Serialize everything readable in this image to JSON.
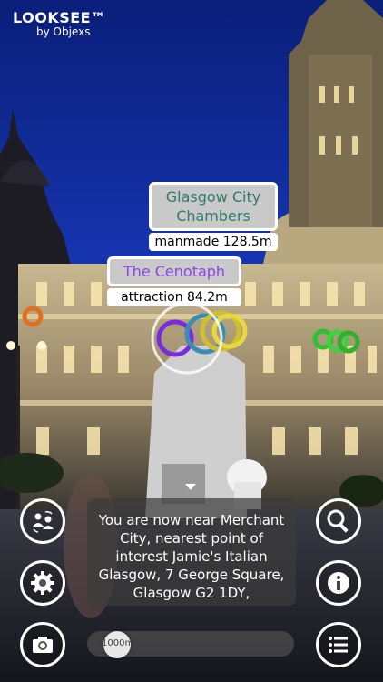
{
  "app": {
    "brand": "LOOKSEE™",
    "byline": "by Objexs"
  },
  "pois": [
    {
      "name": "Glasgow City Chambers",
      "category_distance": "manmade 128.5m"
    },
    {
      "name": "The Cenotaph",
      "category_distance": "attraction 84.2m"
    }
  ],
  "message": "You are now near Merchant City, nearest point of interest Jamie's Italian Glasgow, 7 George Square, Glasgow G2 1DY,",
  "range_slider": {
    "label": "1000m"
  },
  "icons": {
    "share": "people-swap-icon",
    "settings": "gear-icon",
    "camera": "camera-icon",
    "search": "search-icon",
    "info": "info-icon",
    "menu": "menu-icon"
  },
  "colors": {
    "poi_green": "#2e7d6c",
    "poi_purple": "#8e44e6"
  }
}
